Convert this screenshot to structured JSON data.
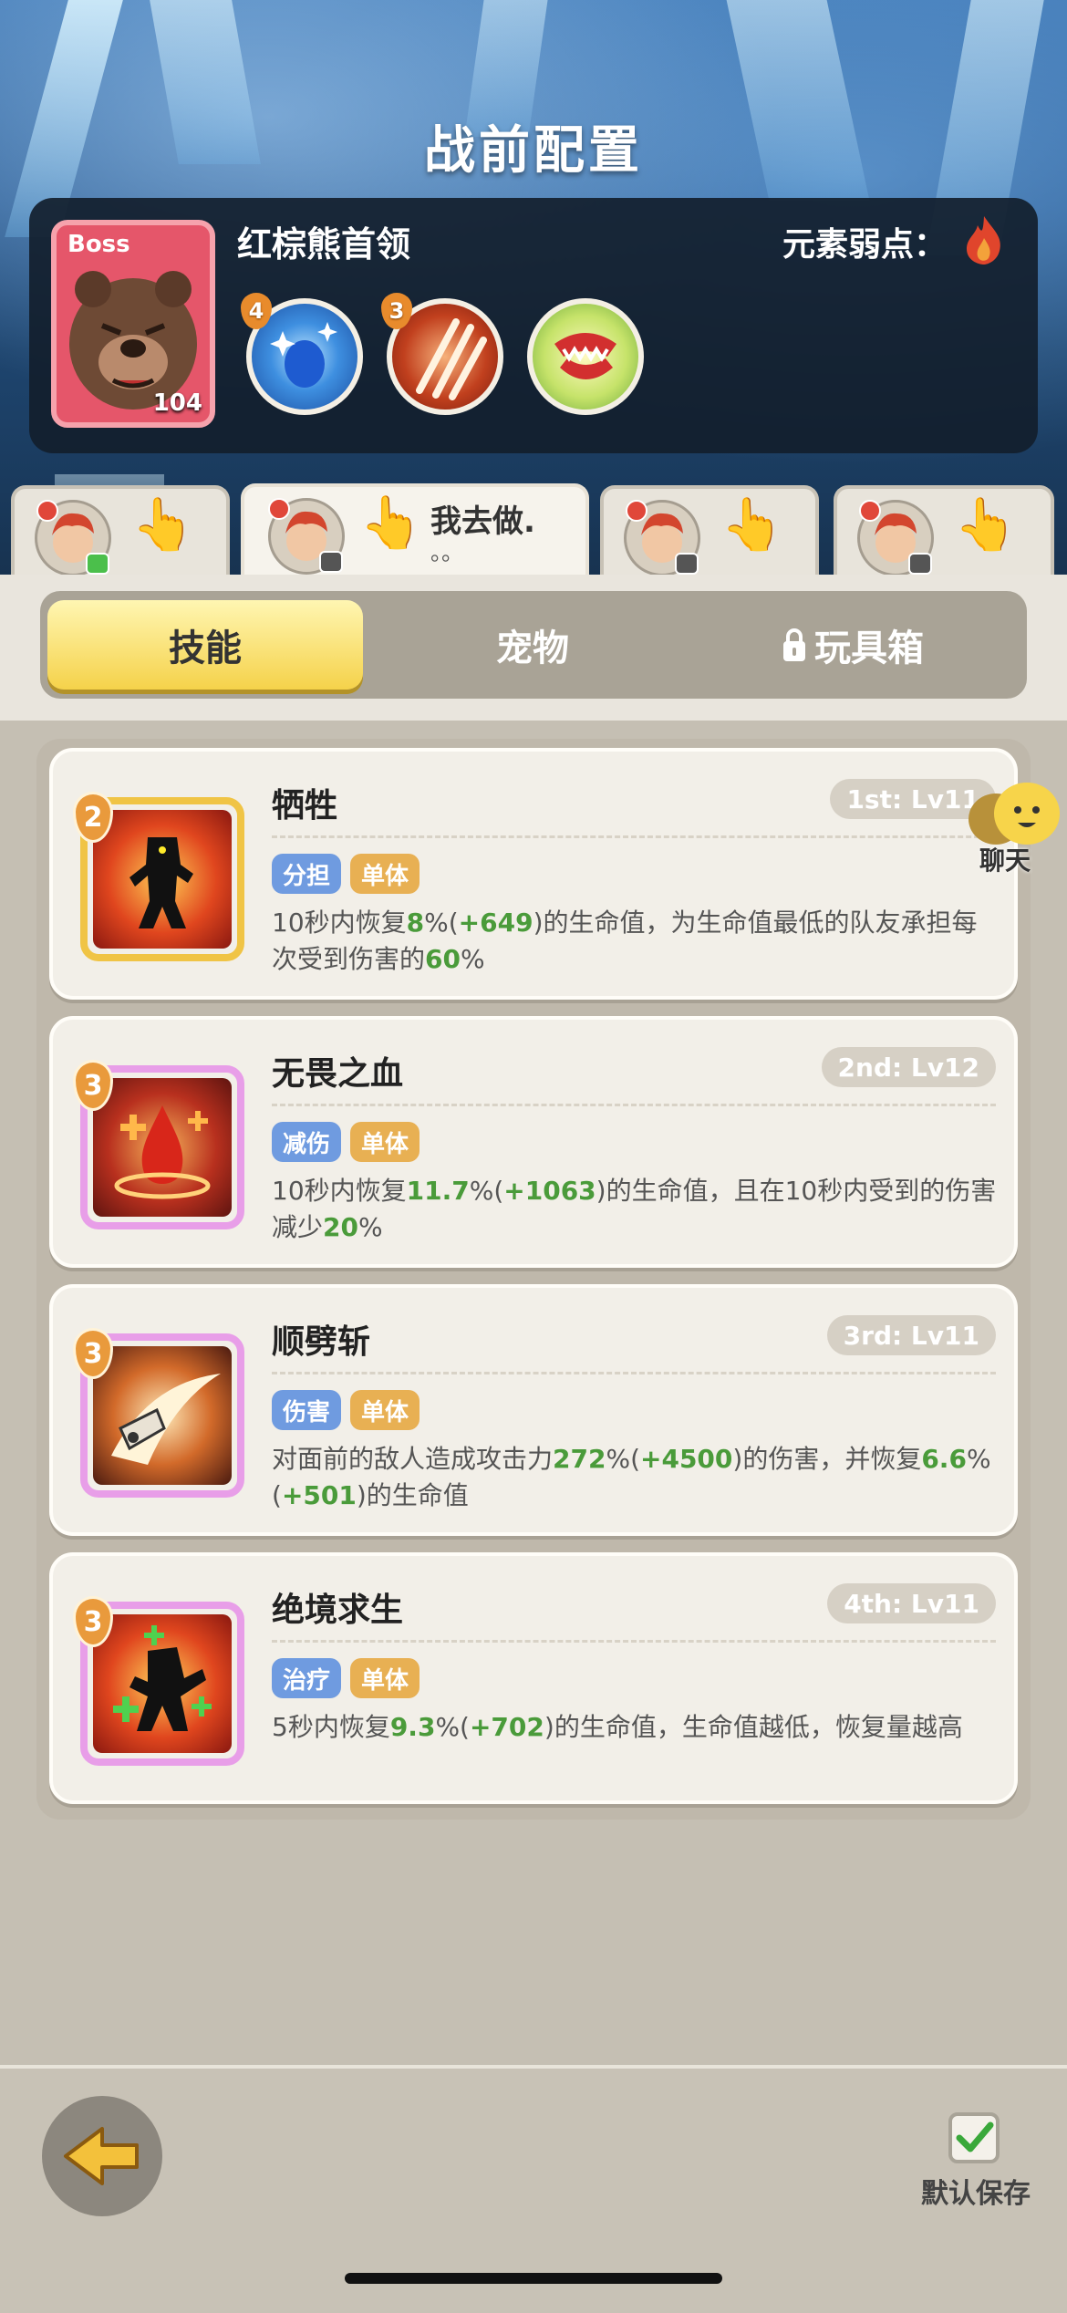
{
  "header": {
    "title": "战前配置"
  },
  "boss": {
    "badge": "Boss",
    "level": "104",
    "name": "红棕熊首领",
    "weakness_label": "元素弱点：",
    "skills": [
      {
        "icon": "blue-orb-icon",
        "count": "4"
      },
      {
        "icon": "claw-slash-icon",
        "count": "3"
      },
      {
        "icon": "bite-icon",
        "count": ""
      }
    ]
  },
  "players": [
    {
      "status": "green",
      "name": ""
    },
    {
      "status": "gray",
      "name": "我去做.",
      "sub": "。。"
    },
    {
      "status": "gray",
      "name": ""
    },
    {
      "status": "gray",
      "name": ""
    }
  ],
  "tabs": [
    {
      "label": "技能",
      "active": true
    },
    {
      "label": "宠物",
      "active": false
    },
    {
      "label": "玩具箱",
      "active": false,
      "locked": true
    }
  ],
  "skills": [
    {
      "cost": "2",
      "name": "牺牲",
      "level": "1st: Lv11",
      "tags": [
        "分担",
        "单体"
      ],
      "desc": [
        {
          "t": "10秒内恢复"
        },
        {
          "t": "8",
          "g": true
        },
        {
          "t": "%("
        },
        {
          "t": "+649",
          "g": true
        },
        {
          "t": ")的生命值，为生命值最低的队友承担每次受到伤害的"
        },
        {
          "t": "60",
          "g": true
        },
        {
          "t": "%"
        }
      ]
    },
    {
      "cost": "3",
      "name": "无畏之血",
      "level": "2nd: Lv12",
      "tags": [
        "减伤",
        "单体"
      ],
      "desc": [
        {
          "t": "10秒内恢复"
        },
        {
          "t": "11.7",
          "g": true
        },
        {
          "t": "%("
        },
        {
          "t": "+1063",
          "g": true
        },
        {
          "t": ")的生命值，且在10秒内受到的伤害减少"
        },
        {
          "t": "20",
          "g": true
        },
        {
          "t": "%"
        }
      ]
    },
    {
      "cost": "3",
      "name": "顺劈斩",
      "level": "3rd: Lv11",
      "tags": [
        "伤害",
        "单体"
      ],
      "desc": [
        {
          "t": "对面前的敌人造成攻击力"
        },
        {
          "t": "272",
          "g": true
        },
        {
          "t": "%("
        },
        {
          "t": "+4500",
          "g": true
        },
        {
          "t": ")的伤害，并恢复"
        },
        {
          "t": "6.6",
          "g": true
        },
        {
          "t": "%("
        },
        {
          "t": "+501",
          "g": true
        },
        {
          "t": ")的生命值"
        }
      ]
    },
    {
      "cost": "3",
      "name": "绝境求生",
      "level": "4th: Lv11",
      "tags": [
        "治疗",
        "单体"
      ],
      "desc": [
        {
          "t": "5秒内恢复"
        },
        {
          "t": "9.3",
          "g": true
        },
        {
          "t": "%("
        },
        {
          "t": "+702",
          "g": true
        },
        {
          "t": ")的生命值，生命值越低，恢复量越高"
        }
      ]
    }
  ],
  "chat": {
    "label": "聊天"
  },
  "footer": {
    "save_label": "默认保存"
  }
}
